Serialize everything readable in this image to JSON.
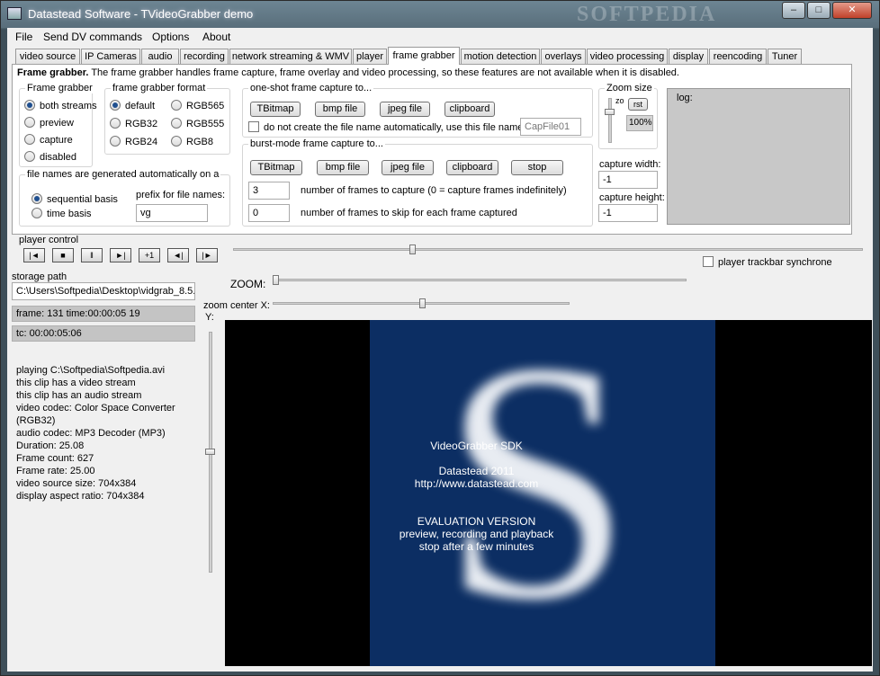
{
  "window": {
    "title": "Datastead Software - TVideoGrabber demo",
    "watermark": "SOFTPEDIA",
    "controls": {
      "minimize": "–",
      "maximize": "□",
      "close": "✕"
    }
  },
  "menu": [
    "File",
    "Send DV commands",
    "Options",
    "About"
  ],
  "tabs": [
    "video source",
    "IP Cameras",
    "audio",
    "recording",
    "network streaming & WMV",
    "player",
    "frame grabber",
    "motion detection",
    "overlays",
    "video processing",
    "display",
    "reencoding",
    "Tuner"
  ],
  "active_tab": "frame grabber",
  "frame_grabber": {
    "header_bold": "Frame grabber.",
    "header_text": " The frame grabber handles frame capture, frame overlay and video processing, so these features are not available when it is disabled.",
    "mode_group": {
      "title": "Frame grabber",
      "options": [
        "both streams",
        "preview",
        "capture",
        "disabled"
      ],
      "selected": "both streams"
    },
    "format_group": {
      "title": "frame grabber format",
      "options": [
        "default",
        "RGB565",
        "RGB32",
        "RGB555",
        "RGB24",
        "RGB8"
      ],
      "selected": "default"
    },
    "file_names_group": {
      "title": "file names are generated automatically on a",
      "options": [
        "sequential basis",
        "time basis"
      ],
      "selected": "sequential basis",
      "prefix_label": "prefix for file names:",
      "prefix_value": "vg"
    },
    "one_shot": {
      "title": "one-shot frame capture to...",
      "buttons": [
        "TBitmap",
        "bmp file",
        "jpeg file",
        "clipboard"
      ],
      "checkbox_label": "do not create the file name automatically, use this file name:",
      "filename_value": "CapFile01"
    },
    "burst": {
      "title": "burst-mode frame capture to...",
      "buttons": [
        "TBitmap",
        "bmp file",
        "jpeg file",
        "clipboard",
        "stop"
      ],
      "frames_to_capture_value": "3",
      "frames_to_capture_label": "number of frames to capture  (0 = capture frames indefinitely)",
      "frames_to_skip_value": "0",
      "frames_to_skip_label": "number of frames to skip for each frame captured"
    },
    "zoom": {
      "title": "Zoom size",
      "slider_label": "zo",
      "rst_label": "rst",
      "value": "100%"
    },
    "capture_width_label": "capture width:",
    "capture_width_value": "-1",
    "capture_height_label": "capture height:",
    "capture_height_value": "-1",
    "log_label": "log:"
  },
  "player_control": {
    "label": "player control",
    "buttons": [
      "|◄",
      "■",
      "‖",
      "►|",
      "+1",
      "◄|",
      "|►"
    ],
    "trackbar_position": 0.28,
    "sync_label": "player trackbar synchrone"
  },
  "storage": {
    "label": "storage path",
    "value": "C:\\Users\\Softpedia\\Desktop\\vidgrab_8.5."
  },
  "frame_info": "frame: 131 time:00:00:05 19",
  "tc_info": "tc: 00:00:05:06",
  "info_lines": [
    "playing C:\\Softpedia\\Softpedia.avi",
    "this clip has a video stream",
    "this clip has an audio stream",
    "",
    "video codec: Color Space Converter (RGB32)",
    "audio codec: MP3 Decoder (MP3)",
    "",
    "Duration: 25.08",
    "Frame count: 627",
    "Frame rate: 25.00",
    "video source size: 704x384",
    "display aspect ratio: 704x384"
  ],
  "zoom_controls": {
    "zoom_label": "ZOOM:",
    "center_label": "zoom center X:",
    "y_label": "Y:"
  },
  "video_overlay": {
    "big_letter": "S",
    "lines": [
      "VideoGrabber SDK",
      "Datastead 2011",
      "http://www.datastead.com",
      "",
      "EVALUATION VERSION",
      "preview, recording and playback",
      "stop after a few minutes"
    ]
  }
}
